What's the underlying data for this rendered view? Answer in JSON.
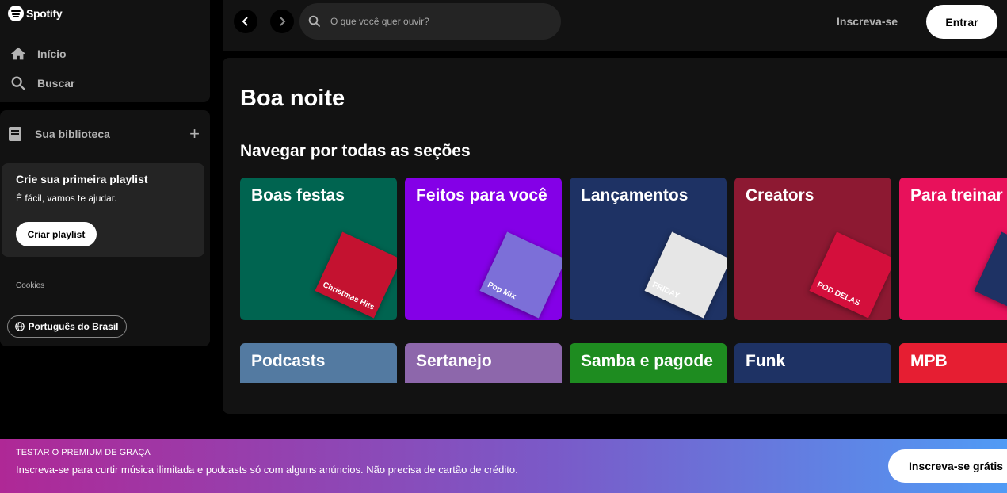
{
  "brand": {
    "name": "Spotify"
  },
  "nav": {
    "items": [
      {
        "label": "Início",
        "icon": "home-icon"
      },
      {
        "label": "Buscar",
        "icon": "search-icon"
      }
    ]
  },
  "library": {
    "title": "Sua biblioteca",
    "add_icon": "plus-icon",
    "create_card": {
      "title": "Crie sua primeira playlist",
      "subtitle": "É fácil, vamos te ajudar.",
      "button_label": "Criar playlist"
    },
    "cookies_label": "Cookies",
    "language_label": "Português do Brasil"
  },
  "topbar": {
    "search_placeholder": "O que você quer ouvir?",
    "signup_label": "Inscreva-se",
    "login_label": "Entrar"
  },
  "main": {
    "greeting": "Boa noite",
    "section_title": "Navegar por todas as seções",
    "tiles_row1": [
      {
        "label": "Boas festas",
        "color": "#006450",
        "art_color": "#c41230",
        "art_text": "Christmas Hits"
      },
      {
        "label": "Feitos para você",
        "color": "#8400e7",
        "art_color": "#7c6fd8",
        "art_text": "Pop Mix"
      },
      {
        "label": "Lançamentos",
        "color": "#1e3264",
        "art_color": "#e6e6e6",
        "art_text": "FRIDAY"
      },
      {
        "label": "Creators",
        "color": "#8d1932",
        "art_color": "#d40f3c",
        "art_text": "POD DELAS"
      },
      {
        "label": "Para treinar",
        "color": "#e8115b",
        "art_color": "#1e3264",
        "art_text": ""
      }
    ],
    "tiles_row2": [
      {
        "label": "Podcasts",
        "color": "#537aa1"
      },
      {
        "label": "Sertanejo",
        "color": "#8d67ab"
      },
      {
        "label": "Samba e pagode",
        "color": "#1e8c20"
      },
      {
        "label": "Funk",
        "color": "#1e3264"
      },
      {
        "label": "MPB",
        "color": "#e61e32"
      }
    ]
  },
  "banner": {
    "title": "TESTAR O PREMIUM DE GRAÇA",
    "text": "Inscreva-se para curtir música ilimitada e podcasts só com alguns anúncios. Não precisa de cartão de crédito.",
    "button_label": "Inscreva-se grátis"
  }
}
